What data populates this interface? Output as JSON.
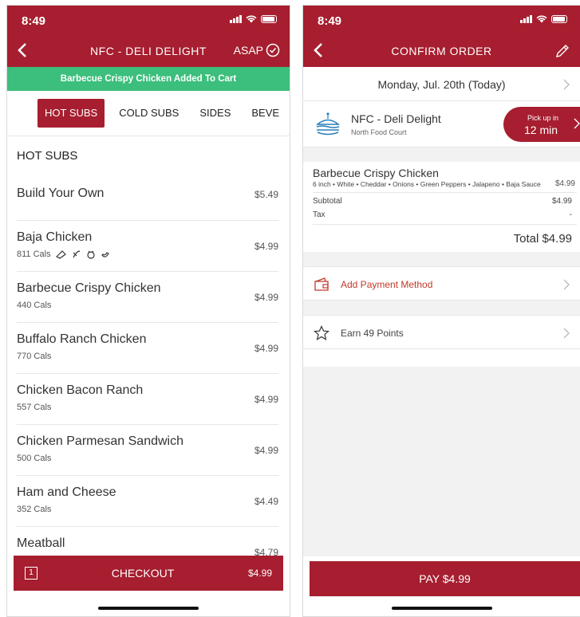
{
  "left": {
    "status": {
      "time": "8:49"
    },
    "nav": {
      "title": "NFC - DELI DELIGHT",
      "asap": "ASAP"
    },
    "banner": "Barbecue Crispy Chicken Added To Cart",
    "tabs": [
      "HOT SUBS",
      "COLD SUBS",
      "SIDES",
      "BEVE"
    ],
    "section_title": "HOT SUBS",
    "items": [
      {
        "name": "Build Your Own",
        "cals": "",
        "price": "$5.49"
      },
      {
        "name": "Baja Chicken",
        "cals": "811 Cals",
        "price": "$4.99"
      },
      {
        "name": "Barbecue Crispy Chicken",
        "cals": "440 Cals",
        "price": "$4.99"
      },
      {
        "name": "Buffalo Ranch Chicken",
        "cals": "770 Cals",
        "price": "$4.99"
      },
      {
        "name": "Chicken Bacon Ranch",
        "cals": "557 Cals",
        "price": "$4.99"
      },
      {
        "name": "Chicken Parmesan Sandwich",
        "cals": "500 Cals",
        "price": "$4.99"
      },
      {
        "name": "Ham and Cheese",
        "cals": "352 Cals",
        "price": "$4.49"
      },
      {
        "name": "Meatball",
        "cals": "",
        "price": "$4.79"
      }
    ],
    "checkout": {
      "count": "1",
      "label": "CHECKOUT",
      "total": "$4.99"
    }
  },
  "right": {
    "status": {
      "time": "8:49"
    },
    "nav": {
      "title": "CONFIRM ORDER"
    },
    "date": "Monday, Jul. 20th (Today)",
    "store": {
      "name": "NFC - Deli Delight",
      "sub": "North Food Court",
      "pickup_label": "Pick up in",
      "pickup_value": "12 min"
    },
    "order": {
      "item_name": "Barbecue Crispy Chicken",
      "item_desc": "6 inch • White • Cheddar • Onions • Green Peppers • Jalapeno • Baja Sauce",
      "item_price": "$4.99",
      "subtotal_label": "Subtotal",
      "subtotal_value": "$4.99",
      "tax_label": "Tax",
      "tax_value": "-",
      "total": "Total $4.99"
    },
    "payment_label": "Add Payment Method",
    "points_label": "Earn 49 Points",
    "pay_label": "PAY $4.99"
  },
  "colors": {
    "brand": "#a61e2f",
    "banner": "#3cbf7c",
    "link": "#c0392b"
  }
}
